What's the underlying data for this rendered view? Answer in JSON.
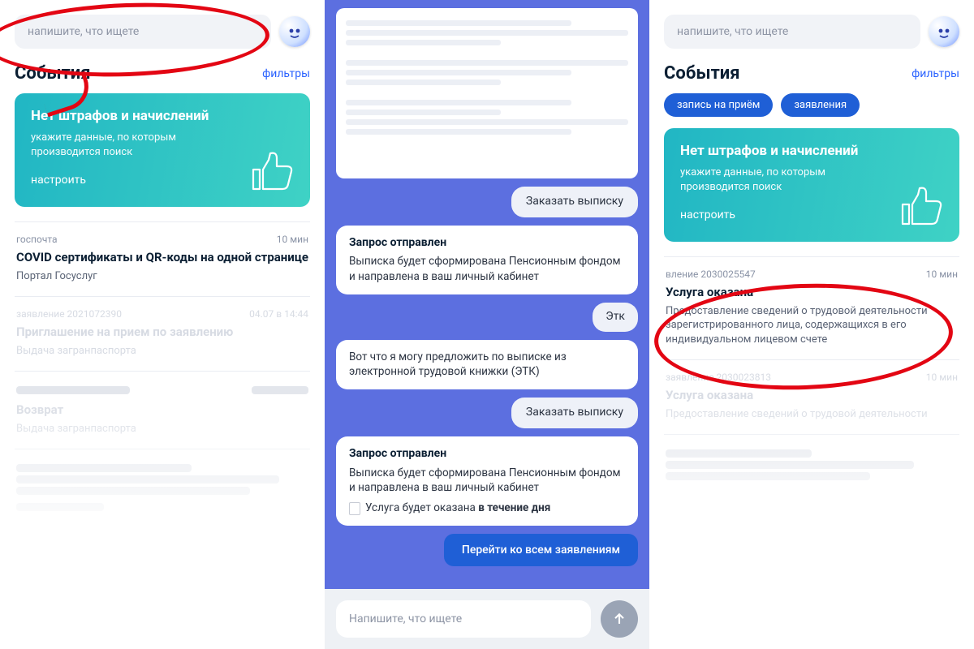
{
  "search_placeholder": "напишите, что ищете",
  "section_title": "События",
  "filters_label": "фильтры",
  "chips": {
    "c1": "запись на приём",
    "c2": "заявления"
  },
  "hero": {
    "title": "Нет штрафов и начислений",
    "sub": "укажите данные, по которым производится поиск",
    "action": "настроить"
  },
  "left_cards": {
    "c1": {
      "tag": "госпочта",
      "time": "10 мин",
      "title": "COVID сертификаты и QR-коды на одной странице",
      "src": "Портал Госуслуг"
    },
    "c2": {
      "tag": "заявление 2021072390",
      "time": "04.07 в 14:44",
      "title": "Приглашение на прием по заявлению",
      "src": "Выдача загранпаспорта"
    },
    "c3": {
      "tag": "",
      "time": "",
      "title": "Возврат",
      "src": "Выдача загранпаспорта"
    }
  },
  "right_cards": {
    "c1": {
      "tag": "вление 2030025547",
      "time": "10 мин",
      "title": "Услуга оказана",
      "body": "Предоставление сведений о трудовой деятельности зарегистрированного лица, содержащихся в его индивидуальном лицевом счете"
    },
    "c2": {
      "tag": "заявление 2030023813",
      "time": "10 мин",
      "title": "Услуга оказана",
      "body": "Предоставление сведений о трудовой деятельности"
    }
  },
  "chat": {
    "order_btn": "Заказать выписку",
    "sent_title": "Запрос отправлен",
    "sent_body": "Выписка будет сформирована Пенсионным фондом и направлена в ваш личный кабинет",
    "etk_chip": "Этк",
    "etk_offer": "Вот что я могу предложить по выписке из электронной трудовой книжки (ЭТК)",
    "sent2_extra_prefix": "Услуга будет оказана ",
    "sent2_extra_bold": "в течение дня",
    "all_apps": "Перейти ко всем заявлениям",
    "input_placeholder": "Напишите, что ищете"
  }
}
